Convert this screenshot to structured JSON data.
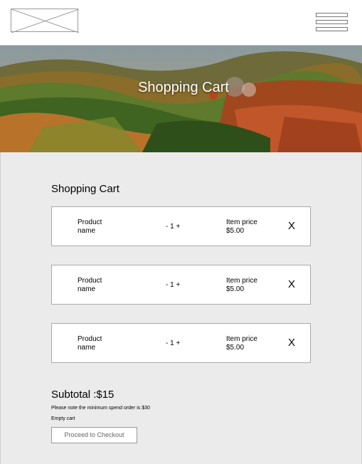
{
  "hero": {
    "title": "Shopping Cart"
  },
  "cart": {
    "heading": "Shopping Cart",
    "items": [
      {
        "product_name": "Product name",
        "qty_minus": "-",
        "qty": "1",
        "qty_plus": "+",
        "price_label": "Item price",
        "price": "$5.00",
        "remove": "X"
      },
      {
        "product_name": "Product name",
        "qty_minus": "-",
        "qty": "1",
        "qty_plus": "+",
        "price_label": "Item price",
        "price": "$5.00",
        "remove": "X"
      },
      {
        "product_name": "Product name",
        "qty_minus": "-",
        "qty": "1",
        "qty_plus": "+",
        "price_label": "Item price",
        "price": "$5.00",
        "remove": "X"
      }
    ],
    "subtotal": "Subtotal :$15",
    "note": "Please note the minimum spend order is $30",
    "empty_cart": "Empty cart",
    "checkout_label": "Proceed to Checkout"
  },
  "icons": {
    "logo": "logo-placeholder-icon",
    "menu": "hamburger-menu-icon"
  }
}
